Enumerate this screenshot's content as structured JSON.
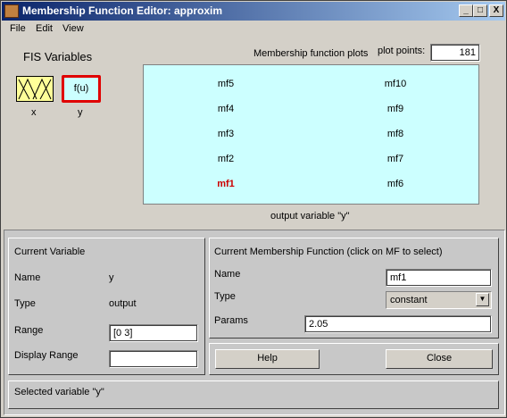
{
  "window": {
    "title": "Membership Function Editor: approxim",
    "minimize_glyph": "_",
    "maximize_glyph": "□",
    "close_glyph": "X"
  },
  "menu": [
    "File",
    "Edit",
    "View"
  ],
  "fis": {
    "heading": "FIS Variables",
    "input_label": "x",
    "output_label": "y",
    "output_box_text": "f(u)"
  },
  "plot": {
    "heading": "Membership function plots",
    "points_label": "plot points:",
    "points_value": "181",
    "caption": "output variable \"y\"",
    "left_mfs": [
      "mf5",
      "mf4",
      "mf3",
      "mf2",
      "mf1"
    ],
    "right_mfs": [
      "mf10",
      "mf9",
      "mf8",
      "mf7",
      "mf6"
    ],
    "selected_mf": "mf1",
    "selected_color": "#cc0000"
  },
  "current_variable": {
    "heading": "Current Variable",
    "name_label": "Name",
    "name_value": "y",
    "type_label": "Type",
    "type_value": "output",
    "range_label": "Range",
    "range_value": "[0 3]",
    "display_range_label": "Display Range",
    "display_range_value": ""
  },
  "current_mf": {
    "heading": "Current Membership Function (click on MF to select)",
    "name_label": "Name",
    "name_value": "mf1",
    "type_label": "Type",
    "type_value": "constant",
    "params_label": "Params",
    "params_value": "2.05"
  },
  "buttons": {
    "help": "Help",
    "close": "Close"
  },
  "status": "Selected variable \"y\""
}
